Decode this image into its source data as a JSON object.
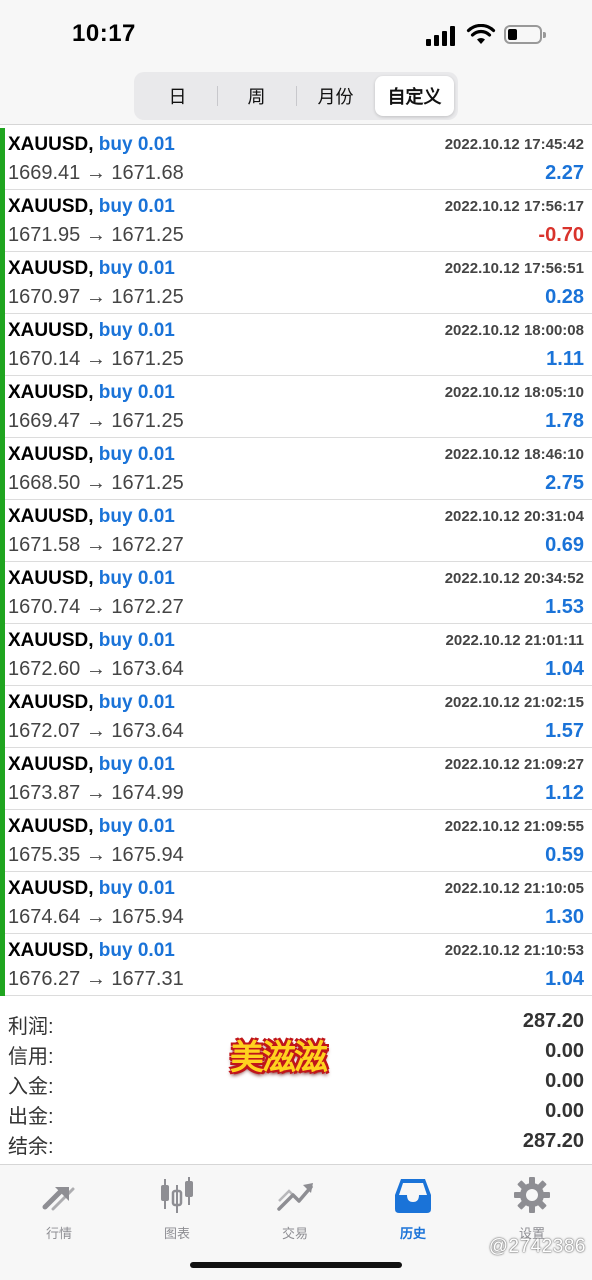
{
  "status_bar": {
    "time": "10:17"
  },
  "segments": [
    {
      "label": "日",
      "active": false
    },
    {
      "label": "周",
      "active": false
    },
    {
      "label": "月份",
      "active": false
    },
    {
      "label": "自定义",
      "active": true
    }
  ],
  "deals": [
    {
      "symbol": "XAUUSD,",
      "side": "buy 0.01",
      "open": "1669.41",
      "close": "1671.68",
      "arrow": "→",
      "datetime": "2022.10.12 17:45:42",
      "profit": "2.27",
      "sign": "pos"
    },
    {
      "symbol": "XAUUSD,",
      "side": "buy 0.01",
      "open": "1671.95",
      "close": "1671.25",
      "arrow": "→",
      "datetime": "2022.10.12 17:56:17",
      "profit": "-0.70",
      "sign": "neg"
    },
    {
      "symbol": "XAUUSD,",
      "side": "buy 0.01",
      "open": "1670.97",
      "close": "1671.25",
      "arrow": "→",
      "datetime": "2022.10.12 17:56:51",
      "profit": "0.28",
      "sign": "pos"
    },
    {
      "symbol": "XAUUSD,",
      "side": "buy 0.01",
      "open": "1670.14",
      "close": "1671.25",
      "arrow": "→",
      "datetime": "2022.10.12 18:00:08",
      "profit": "1.11",
      "sign": "pos"
    },
    {
      "symbol": "XAUUSD,",
      "side": "buy 0.01",
      "open": "1669.47",
      "close": "1671.25",
      "arrow": "→",
      "datetime": "2022.10.12 18:05:10",
      "profit": "1.78",
      "sign": "pos"
    },
    {
      "symbol": "XAUUSD,",
      "side": "buy 0.01",
      "open": "1668.50",
      "close": "1671.25",
      "arrow": "→",
      "datetime": "2022.10.12 18:46:10",
      "profit": "2.75",
      "sign": "pos"
    },
    {
      "symbol": "XAUUSD,",
      "side": "buy 0.01",
      "open": "1671.58",
      "close": "1672.27",
      "arrow": "→",
      "datetime": "2022.10.12 20:31:04",
      "profit": "0.69",
      "sign": "pos"
    },
    {
      "symbol": "XAUUSD,",
      "side": "buy 0.01",
      "open": "1670.74",
      "close": "1672.27",
      "arrow": "→",
      "datetime": "2022.10.12 20:34:52",
      "profit": "1.53",
      "sign": "pos"
    },
    {
      "symbol": "XAUUSD,",
      "side": "buy 0.01",
      "open": "1672.60",
      "close": "1673.64",
      "arrow": "→",
      "datetime": "2022.10.12 21:01:11",
      "profit": "1.04",
      "sign": "pos"
    },
    {
      "symbol": "XAUUSD,",
      "side": "buy 0.01",
      "open": "1672.07",
      "close": "1673.64",
      "arrow": "→",
      "datetime": "2022.10.12 21:02:15",
      "profit": "1.57",
      "sign": "pos"
    },
    {
      "symbol": "XAUUSD,",
      "side": "buy 0.01",
      "open": "1673.87",
      "close": "1674.99",
      "arrow": "→",
      "datetime": "2022.10.12 21:09:27",
      "profit": "1.12",
      "sign": "pos"
    },
    {
      "symbol": "XAUUSD,",
      "side": "buy 0.01",
      "open": "1675.35",
      "close": "1675.94",
      "arrow": "→",
      "datetime": "2022.10.12 21:09:55",
      "profit": "0.59",
      "sign": "pos"
    },
    {
      "symbol": "XAUUSD,",
      "side": "buy 0.01",
      "open": "1674.64",
      "close": "1675.94",
      "arrow": "→",
      "datetime": "2022.10.12 21:10:05",
      "profit": "1.30",
      "sign": "pos"
    },
    {
      "symbol": "XAUUSD,",
      "side": "buy 0.01",
      "open": "1676.27",
      "close": "1677.31",
      "arrow": "→",
      "datetime": "2022.10.12 21:10:53",
      "profit": "1.04",
      "sign": "pos"
    }
  ],
  "summary": [
    {
      "label": "利润:",
      "value": "287.20"
    },
    {
      "label": "信用:",
      "value": "0.00"
    },
    {
      "label": "入金:",
      "value": "0.00"
    },
    {
      "label": "出金:",
      "value": "0.00"
    },
    {
      "label": "结余:",
      "value": "287.20"
    }
  ],
  "watermark_text": "美滋滋",
  "tabs": [
    {
      "label": "行情",
      "icon": "quotes-arrows-icon",
      "active": false
    },
    {
      "label": "图表",
      "icon": "candlestick-chart-icon",
      "active": false
    },
    {
      "label": "交易",
      "icon": "trade-trend-icon",
      "active": false
    },
    {
      "label": "历史",
      "icon": "history-inbox-icon",
      "active": true
    },
    {
      "label": "设置",
      "icon": "settings-gear-icon",
      "active": false
    }
  ],
  "credit": "@2742386",
  "colors": {
    "buy": "#1a73d8",
    "profit_pos": "#1a73d8",
    "profit_neg": "#d9332c",
    "deal_bar": "#1fa51f",
    "tab_active": "#1a73d8",
    "tab_inactive": "#8e8e93"
  }
}
